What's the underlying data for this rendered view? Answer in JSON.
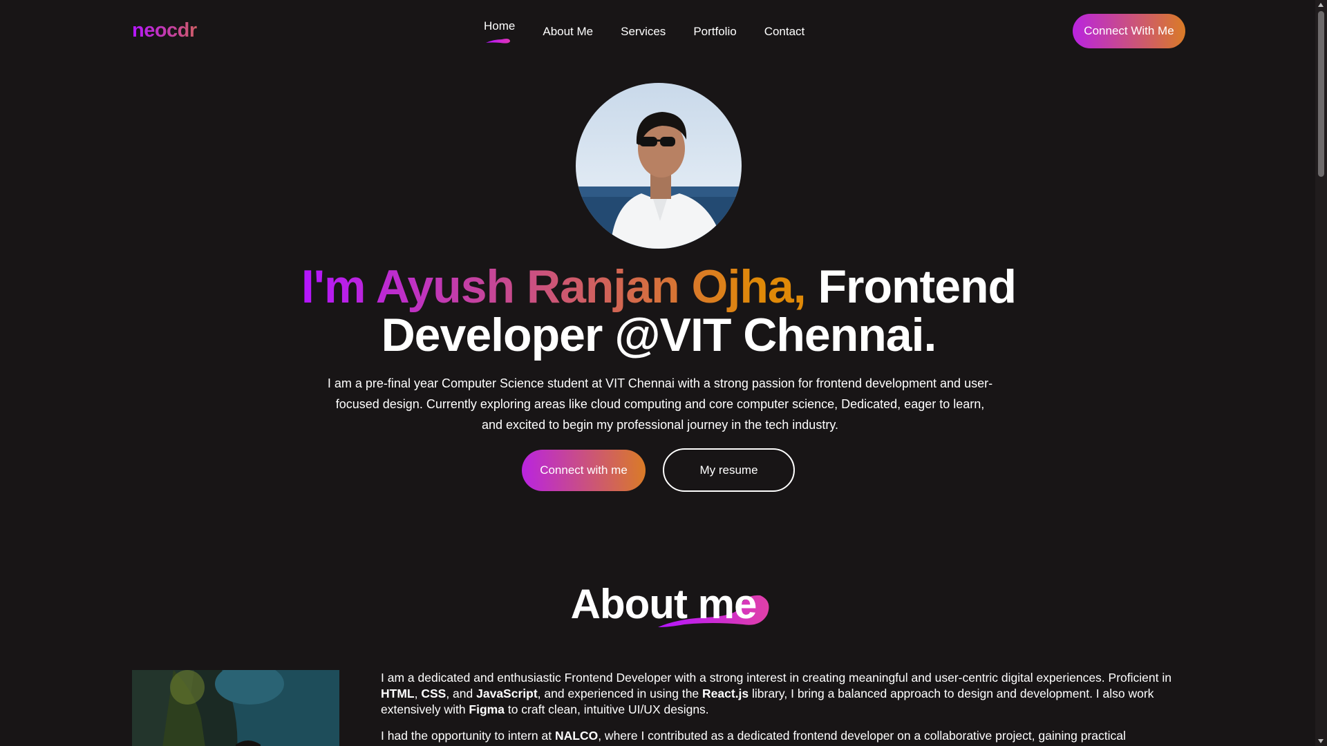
{
  "header": {
    "logo": "neocdr",
    "nav": [
      "Home",
      "About Me",
      "Services",
      "Portfolio",
      "Contact"
    ],
    "active_nav": "Home",
    "cta_label": "Connect With Me"
  },
  "hero": {
    "title_name": "I'm Ayush Ranjan Ojha,",
    "title_rest": " Frontend Developer @VIT Chennai.",
    "description": "I am a pre-final year Computer Science student at VIT Chennai with a strong passion for frontend development and user-focused design. Currently exploring areas like cloud computing and core computer science, Dedicated, eager to learn, and excited to begin my professional journey in the tech industry.",
    "connect_label": "Connect with me",
    "resume_label": "My resume"
  },
  "about": {
    "heading": "About me",
    "p1_a": "I am a dedicated and enthusiastic Frontend Developer with a strong interest in creating meaningful and user-centric digital experiences. Proficient in ",
    "p1_html": "HTML",
    "p1_sep1": ", ",
    "p1_css": "CSS",
    "p1_sep2": ", and ",
    "p1_js": "JavaScript",
    "p1_b": ", and experienced in using the ",
    "p1_react": "React.js",
    "p1_c": " library, I bring a balanced approach to design and development. I also work extensively with ",
    "p1_figma": "Figma",
    "p1_d": " to craft clean, intuitive UI/UX designs.",
    "p2_a": "I had the opportunity to intern at ",
    "p2_nalco": "NALCO",
    "p2_b": ", where I contributed as a dedicated frontend developer on a collaborative project, gaining practical"
  },
  "colors": {
    "background": "#181516",
    "gradient_start": "#b415ff",
    "gradient_end": "#df8908"
  },
  "icons": [
    "nav-underline-swoosh",
    "about-swoosh"
  ]
}
